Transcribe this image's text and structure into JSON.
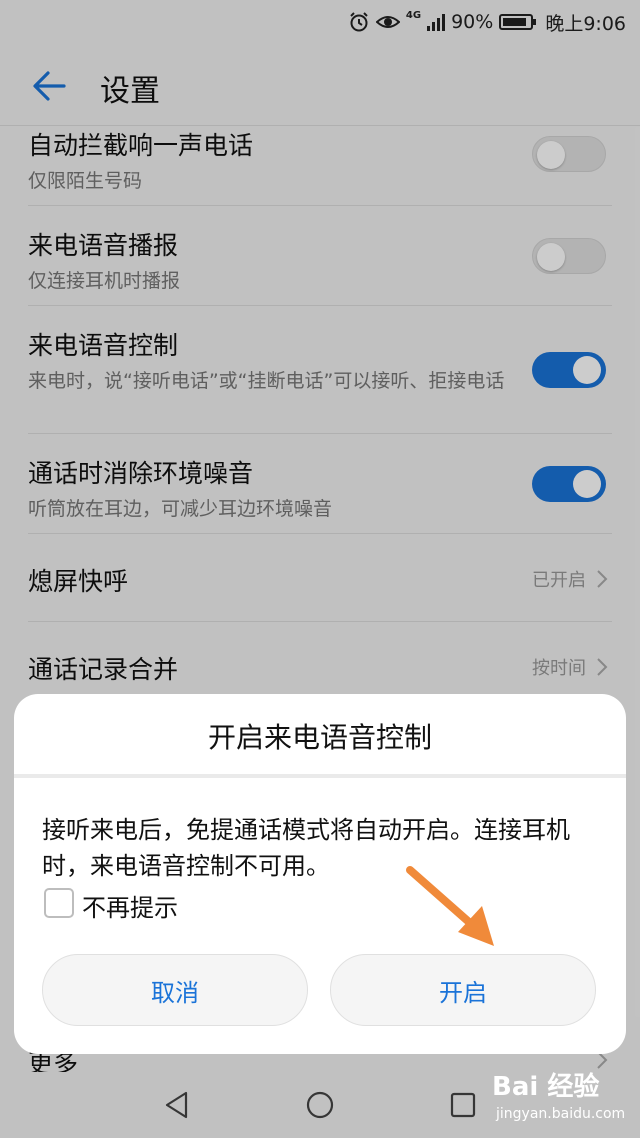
{
  "status_bar": {
    "network": "4G",
    "battery_text": "90%",
    "battery_level": 0.9,
    "time": "晚上9:06"
  },
  "header": {
    "title": "设置",
    "back_icon": "arrow-left-icon"
  },
  "settings": [
    {
      "title": "自动拦截响一声电话",
      "subtitle": "仅限陌生号码",
      "toggle": "off"
    },
    {
      "title": "来电语音播报",
      "subtitle": "仅连接耳机时播报",
      "toggle": "off"
    },
    {
      "title": "来电语音控制",
      "subtitle": "来电时，说“接听电话”或“挂断电话”可以接听、拒接电话",
      "toggle": "on"
    },
    {
      "title": "通话时消除环境噪音",
      "subtitle": "听筒放在耳边，可减少耳边环境噪音",
      "toggle": "on"
    },
    {
      "title": "熄屏快呼",
      "value": "已开启"
    },
    {
      "title": "通话记录合并",
      "value": "按时间"
    },
    {
      "title": "更多"
    }
  ],
  "dialog": {
    "title": "开启来电语音控制",
    "message": "接听来电后，免提通话模式将自动开启。连接耳机时，来电语音控制不可用。",
    "checkbox_label": "不再提示",
    "cancel_label": "取消",
    "confirm_label": "开启"
  },
  "watermark": {
    "brand": "Bai 经验",
    "url": "jingyan.baidu.com"
  },
  "colors": {
    "accent": "#1a73d8",
    "arrow": "#f08a3a",
    "background": "#f2f2f2"
  }
}
